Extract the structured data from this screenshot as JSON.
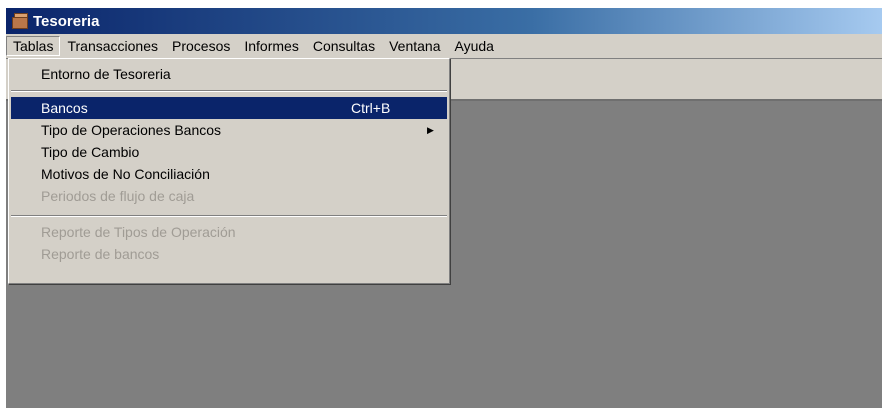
{
  "window": {
    "title": "Tesoreria"
  },
  "menubar": [
    "Tablas",
    "Transacciones",
    "Procesos",
    "Informes",
    "Consultas",
    "Ventana",
    "Ayuda"
  ],
  "dropdown": {
    "items": [
      {
        "label": "Entorno de Tesoreria",
        "state": "enabled"
      },
      {
        "label": "Bancos",
        "shortcut": "Ctrl+B",
        "state": "selected"
      },
      {
        "label": "Tipo de Operaciones Bancos",
        "submenu": true,
        "state": "enabled"
      },
      {
        "label": "Tipo de Cambio",
        "state": "enabled"
      },
      {
        "label": "Motivos de No Conciliación",
        "state": "enabled"
      },
      {
        "label": "Periodos de flujo de caja",
        "state": "disabled"
      },
      {
        "label": "Reporte de Tipos de Operación",
        "state": "disabled"
      },
      {
        "label": "Reporte de bancos",
        "state": "disabled"
      }
    ]
  },
  "colors": {
    "title_bar": "#0a246a",
    "menu_bg": "#d4d0c8",
    "selection": "#0a246a",
    "workspace": "#7f7f7f",
    "disabled_text": "#a09c95"
  },
  "icons": {
    "app": "treasury-box-icon",
    "submenu": "submenu-arrow-icon"
  }
}
